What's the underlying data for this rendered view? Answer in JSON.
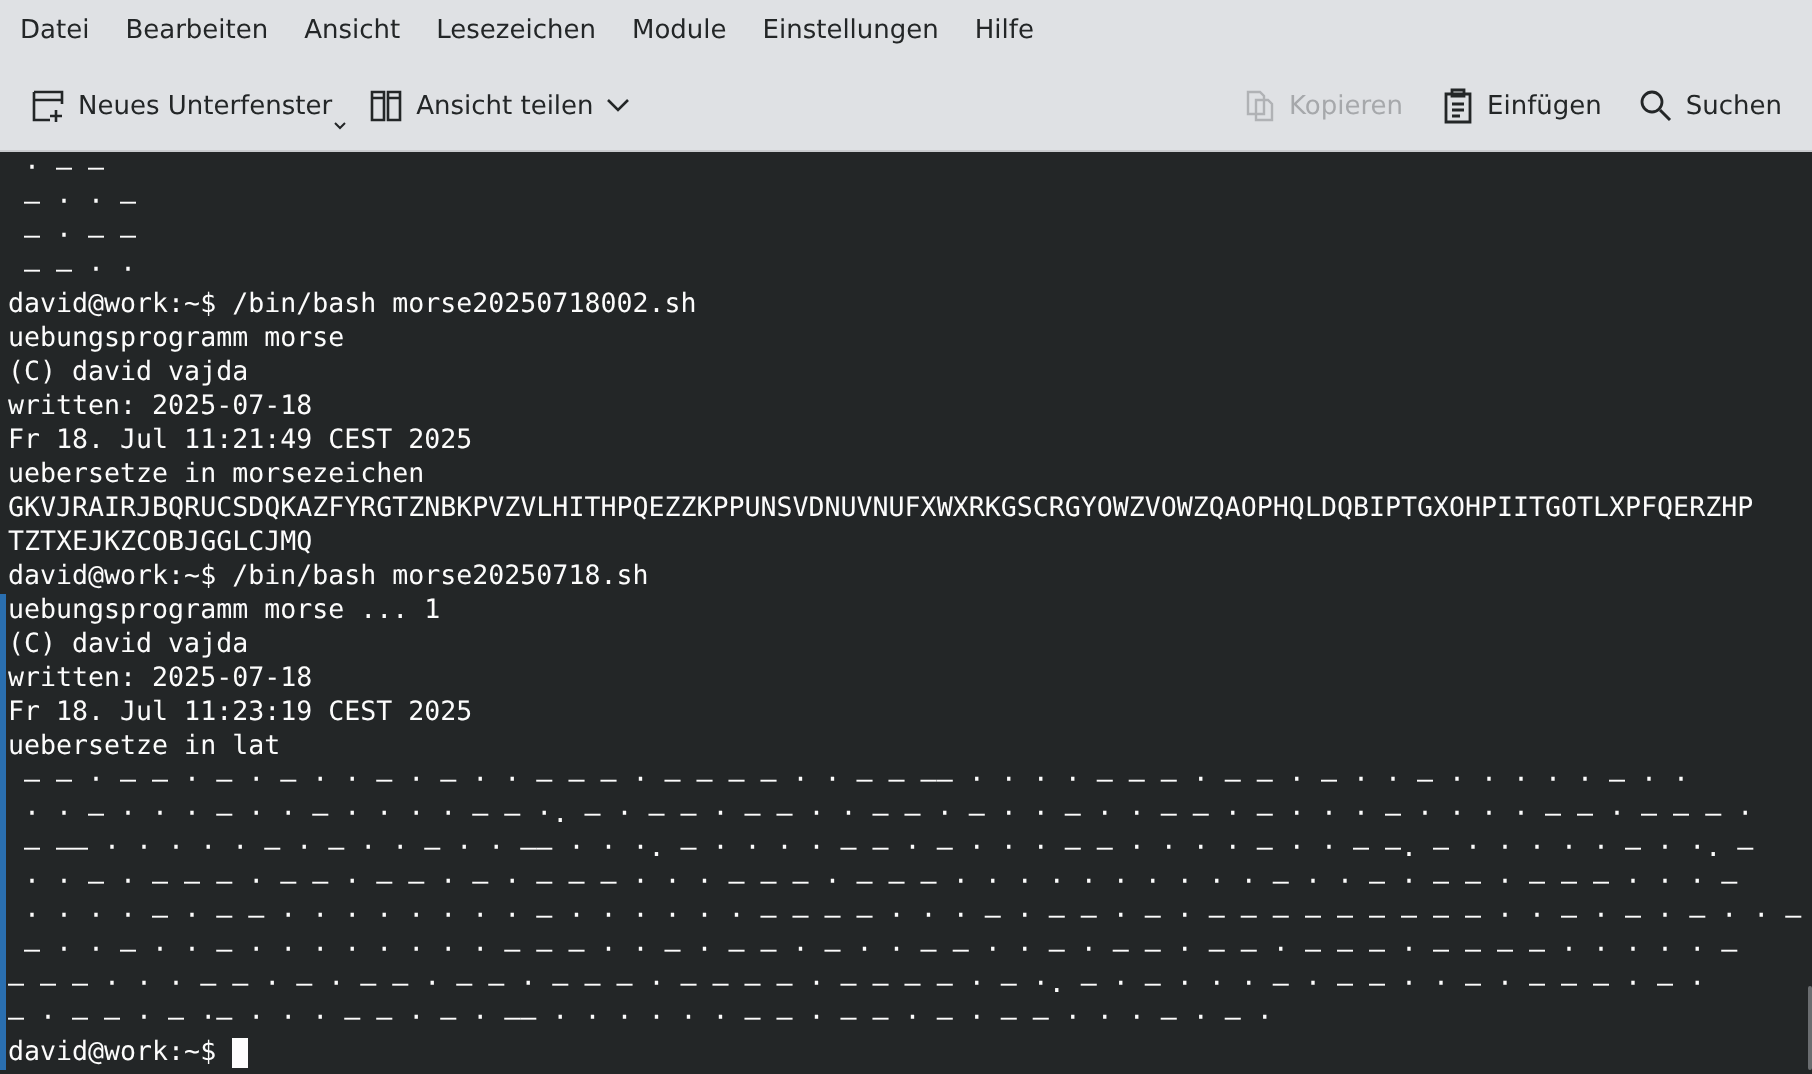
{
  "menu": [
    {
      "label": "Datei"
    },
    {
      "label": "Bearbeiten"
    },
    {
      "label": "Ansicht"
    },
    {
      "label": "Lesezeichen"
    },
    {
      "label": "Module"
    },
    {
      "label": "Einstellungen"
    },
    {
      "label": "Hilfe"
    }
  ],
  "toolbar": {
    "left": [
      {
        "label": "Neues Unterfenster",
        "kind": "new-tab",
        "disabled": false
      },
      {
        "label": "Ansicht teilen",
        "kind": "split",
        "disabled": false
      }
    ],
    "right": [
      {
        "label": "Kopieren",
        "kind": "copy",
        "disabled": true
      },
      {
        "label": "Einfügen",
        "kind": "paste",
        "disabled": false
      },
      {
        "label": "Suchen",
        "kind": "search",
        "disabled": false
      }
    ]
  },
  "terminal": {
    "blocks": [
      {
        "highlighted": false,
        "lines": [
          " · – –",
          " – · · –",
          " – · – –",
          " – – · ·",
          "david@work:~$ /bin/bash morse20250718002.sh",
          "uebungsprogramm morse",
          "(C) david vajda",
          "written: 2025-07-18",
          "Fr 18. Jul 11:21:49 CEST 2025",
          "uebersetze in morsezeichen",
          "GKVJRAIRJBQRUCSDQKAZFYRGTZNBKPVZVLHITHPQEZZKPPUNSVDNUVNUFXWXRKGSCRGYOWZVOWZQAOPHQLDQBIPTGXOHPIITGOTLXPFQERZHP",
          "TZTXEJKZCOBJGGLCJMQ",
          "david@work:~$ /bin/bash morse20250718.sh"
        ]
      },
      {
        "highlighted": true,
        "lines": [
          "uebungsprogramm morse ... 1",
          "(C) david vajda",
          "written: 2025-07-18",
          "Fr 18. Jul 11:23:19 CEST 2025",
          "uebersetze in lat",
          " – – · – – · – · – · · – · – · · – – – · – – – – · · – – –– · · · · – – – · – – · – · · – · · · · · – · ·",
          " · · – · · · – · · – · · · · – – ·. – · – – · – – · · – – · – · · – · · – – · – · · · – · · · · – – · – – – ·",
          " – –– · · · · · – · – · · – · · –– · · ·. – · · · · – – · – · · · – – · · · · – · · – –. – · · · · · – · ·. –",
          " · · – · – – – · – – · – – · – · – – – · · · – – – · – – – · · · · · · · · · · – · · – · – – · – – – · · · –",
          " · · · · – · – – · · · · · · · · – · · · · · · – – – – · · · – · – – · – · – – – – – – – – – · · – · – · – · · –",
          " – · · – · · – · · · · · · · · – – – · · – · – – · – · · – – · · – · – – · – – · – – – · – – – – · · · · · –",
          "– – – · · · – – · – · – – · – – · – – – · – – – – · – – – – · – ·. – · – · · · – · – – · · – · – – – · – ·",
          "– · – – · – ·– · · · – – · – · –– · · · · · · – – · – – · – · – – · · · – · – ·"
        ],
        "prompt": "david@work:~$ ",
        "cursor": true
      }
    ]
  }
}
